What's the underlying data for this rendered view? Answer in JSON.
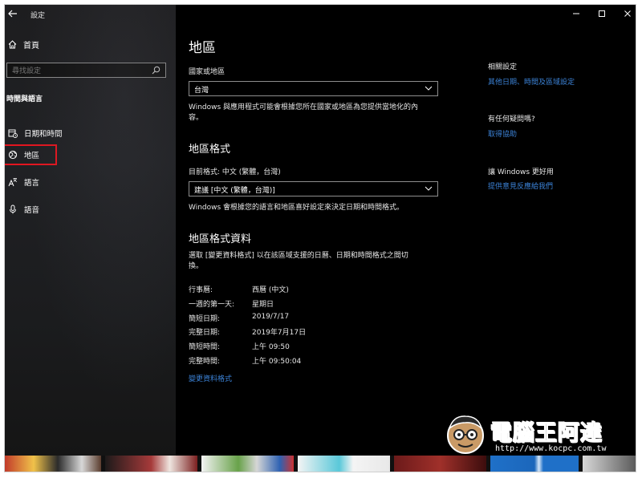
{
  "window": {
    "title": "設定",
    "controls": [
      "minimize",
      "maximize",
      "close"
    ]
  },
  "sidebar": {
    "home_label": "首頁",
    "search_placeholder": "尋找設定",
    "section_title": "時間與語言",
    "items": [
      {
        "label": "日期和時間",
        "icon": "calendar-clock-icon"
      },
      {
        "label": "地區",
        "icon": "globe-region-icon",
        "selected": true
      },
      {
        "label": "語言",
        "icon": "language-icon"
      },
      {
        "label": "語音",
        "icon": "microphone-icon"
      }
    ]
  },
  "main": {
    "title": "地區",
    "country": {
      "label": "國家或地區",
      "value": "台灣",
      "description": [
        "Windows 與應用程式可能會根據您所在國家或地區為您提供當地化的內",
        "容。"
      ]
    },
    "format": {
      "heading": "地區格式",
      "current_label": "目前格式: 中文 (繁體，台灣)",
      "value": "建議 [中文 (繁體，台灣)]",
      "description": "Windows 會根據您的語言和地區喜好設定來決定日期和時間格式。"
    },
    "data": {
      "heading": "地區格式資料",
      "description": [
        "選取 [變更資料格式] 以在該區域支援的日曆、日期和時間格式之間切",
        "換。"
      ],
      "rows": [
        {
          "key": "行事曆:",
          "value": "西曆 (中文)"
        },
        {
          "key": "一週的第一天:",
          "value": "星期日"
        },
        {
          "key": "簡短日期:",
          "value": "2019/7/17"
        },
        {
          "key": "完整日期:",
          "value": "2019年7月17日"
        },
        {
          "key": "簡短時間:",
          "value": "上午 09:50"
        },
        {
          "key": "完整時間:",
          "value": "上午 09:50:04"
        }
      ],
      "change_link": "變更資料格式"
    }
  },
  "related": {
    "heading": "相關設定",
    "link": "其他日期、時間及區域設定",
    "help_heading": "有任何疑問嗎?",
    "help_link": "取得協助",
    "improve_heading": "讓 Windows 更好用",
    "improve_link": "提供意見反應給我們"
  },
  "watermark": {
    "text": "電腦王阿達",
    "url": "http://www.kocpc.com.tw"
  },
  "colors": {
    "accent_link": "#3b82d6",
    "selection_outline": "#e3151f",
    "background": "#000000"
  }
}
